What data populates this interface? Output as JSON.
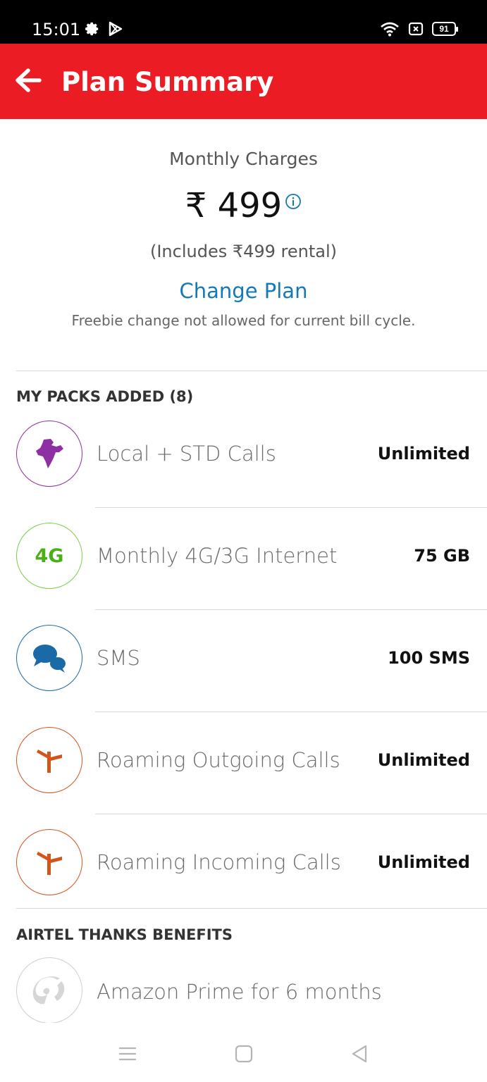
{
  "status_bar": {
    "time": "15:01",
    "battery": "91",
    "icons": [
      "gear-icon",
      "play-store-icon",
      "wifi-icon",
      "notification-icon",
      "battery-icon"
    ]
  },
  "header": {
    "title": "Plan Summary",
    "background_color": "#ec1c24"
  },
  "summary": {
    "monthly_label": "Monthly Charges",
    "price": "₹ 499",
    "rental_note": "(Includes ₹499 rental)",
    "change_plan_label": "Change Plan",
    "freebie_note": "Freebie change not allowed for current bill cycle."
  },
  "packs": {
    "header": "MY PACKS ADDED (8)",
    "items": [
      {
        "label": "Local + STD Calls",
        "value": "Unlimited",
        "icon": "india-map-icon",
        "color": "#8e2fa3"
      },
      {
        "label": "Monthly 4G/3G Internet",
        "value": "75 GB",
        "icon": "4g-icon",
        "icon_text": "4G",
        "color": "#4caf1a"
      },
      {
        "label": "SMS",
        "value": "100 SMS",
        "icon": "chat-bubbles-icon",
        "color": "#1a6aa8"
      },
      {
        "label": "Roaming Outgoing Calls",
        "value": "Unlimited",
        "icon": "signpost-icon",
        "color": "#d4541c"
      },
      {
        "label": "Roaming Incoming Calls",
        "value": "Unlimited",
        "icon": "signpost-icon",
        "color": "#d4541c"
      }
    ]
  },
  "benefits": {
    "header": "AIRTEL THANKS BENEFITS",
    "items": [
      {
        "label": "Amazon Prime for 6 months",
        "icon": "airtel-logo-icon"
      }
    ]
  },
  "nav_bar": {
    "icons": [
      "menu-icon",
      "home-icon",
      "back-icon"
    ]
  }
}
